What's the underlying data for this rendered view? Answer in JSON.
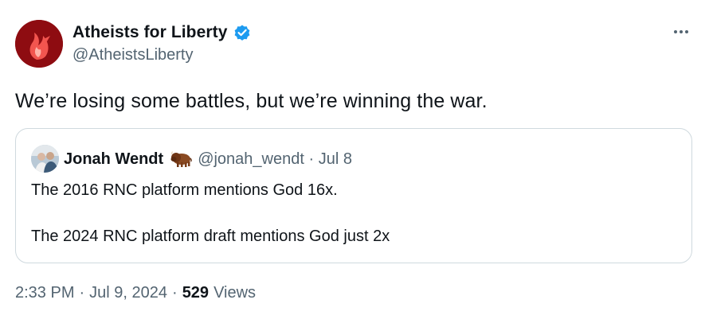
{
  "author": {
    "display_name": "Atheists for Liberty",
    "handle": "@AtheistsLiberty",
    "avatar_icon": "flame-eagle-logo",
    "verified_icon": "verified-badge-icon",
    "accent": "#1d9bf0",
    "avatar_bg": "#8e0c11"
  },
  "tweet": {
    "text": "We’re losing some battles, but we’re winning the war.",
    "more_icon": "more-options-icon"
  },
  "quote": {
    "display_name": "Jonah Wendt",
    "emoji_icon": "bison-emoji-icon",
    "meta": "@jonah_wendt · Jul 8",
    "line1": "The 2016 RNC platform mentions God 16x.",
    "line2": "The 2024 RNC platform draft mentions God just 2x"
  },
  "footer": {
    "time": "2:33 PM",
    "date": "Jul 9, 2024",
    "separator": "·",
    "views_count": "529",
    "views_label": "Views"
  }
}
